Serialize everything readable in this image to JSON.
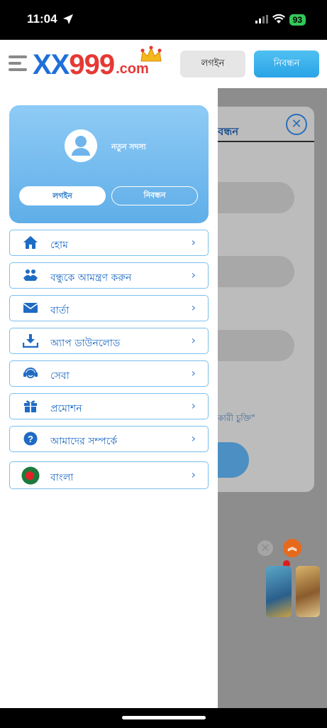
{
  "status_bar": {
    "time": "11:04",
    "battery": "93"
  },
  "header": {
    "logo_part1": "XX",
    "logo_part2": "999",
    "logo_part3": ".com",
    "login_label": "লগইন",
    "register_label": "নিবন্ধন"
  },
  "drawer": {
    "profile": {
      "username": "নতুন সদস্য",
      "login_label": "লগইন",
      "register_label": "নিবন্ধন"
    },
    "menu": [
      {
        "label": "হোম",
        "icon": "home-icon"
      },
      {
        "label": "বন্ধুকে আমন্ত্রণ করুন",
        "icon": "invite-friend-icon"
      },
      {
        "label": "বার্তা",
        "icon": "message-icon"
      },
      {
        "label": "অ্যাপ ডাউনলোড",
        "icon": "download-icon"
      },
      {
        "label": "সেবা",
        "icon": "support-icon"
      },
      {
        "label": "প্রমোশন",
        "icon": "gift-icon"
      },
      {
        "label": "আমাদের সম্পর্কে",
        "icon": "help-icon"
      },
      {
        "label": "বাংলা",
        "icon": "bangladesh-flag-icon"
      }
    ]
  },
  "background_modal": {
    "title_fragment": "বন্ধন",
    "terms_fragment": "কারী চুক্তি\""
  },
  "colors": {
    "brand_blue": "#1e6fd9",
    "brand_red": "#e53935",
    "menu_text": "#1e6bc4",
    "menu_border": "#7cc0ec",
    "profile_gradient_top": "#8fcbf6",
    "profile_gradient_bottom": "#5faee8"
  }
}
